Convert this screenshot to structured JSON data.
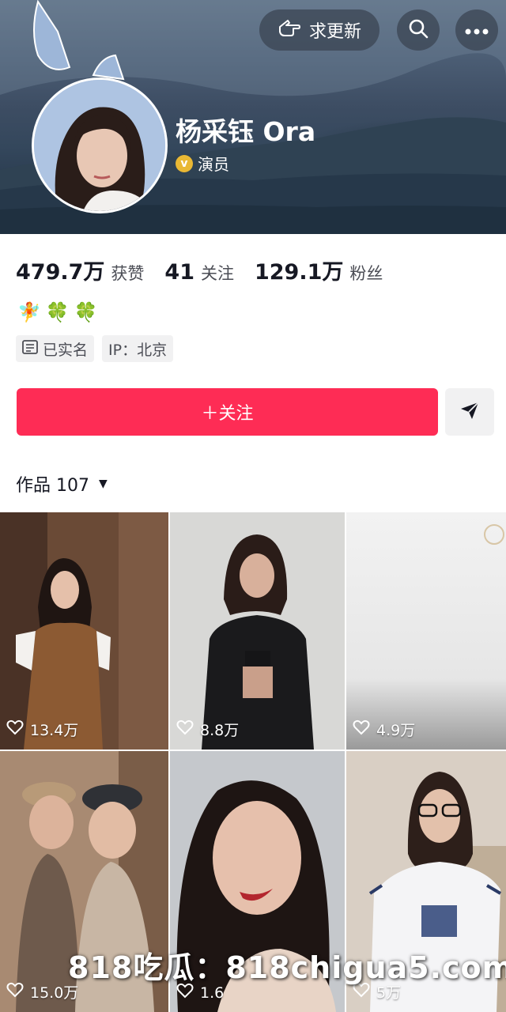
{
  "header": {
    "update_label": "求更新",
    "name": "杨采钰 Ora",
    "role": "演员",
    "verified_color": "#e9b834"
  },
  "stats": [
    {
      "num": "479.7万",
      "label": "获赞"
    },
    {
      "num": "41",
      "label": "关注"
    },
    {
      "num": "129.1万",
      "label": "粉丝"
    }
  ],
  "signature_emojis": [
    "🧚",
    "🍀",
    "🍀"
  ],
  "tags": {
    "verified": "已实名",
    "ip": "IP：北京"
  },
  "actions": {
    "follow_label": "＋关注",
    "follow_color": "#fe2c55"
  },
  "works": {
    "label": "作品",
    "count": "107"
  },
  "videos": [
    {
      "likes": "13.4万"
    },
    {
      "likes": "8.8万"
    },
    {
      "likes": "4.9万"
    },
    {
      "likes": "15.0万"
    },
    {
      "likes": "1.6"
    },
    {
      "likes": "5万"
    }
  ],
  "watermark": "818吃瓜：818chigua5.com"
}
